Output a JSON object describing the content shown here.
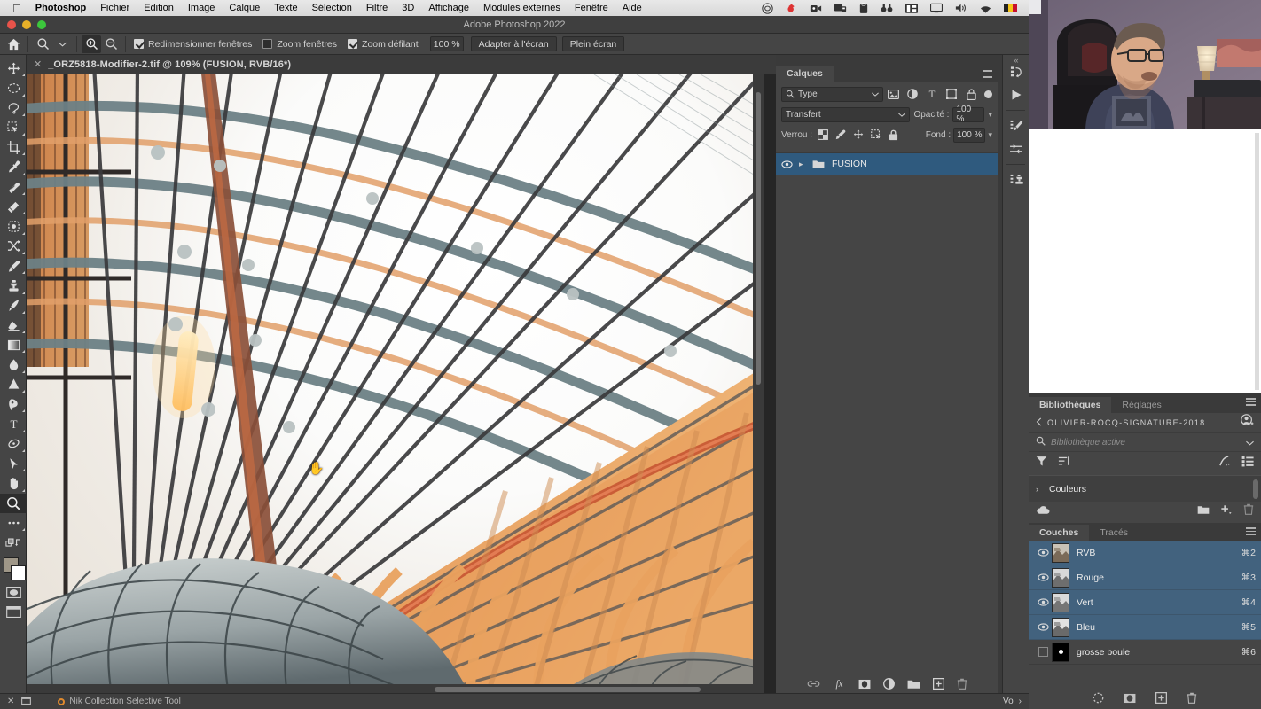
{
  "macmenu": {
    "apple": "apple-logo",
    "items": [
      "Photoshop",
      "Fichier",
      "Edition",
      "Image",
      "Calque",
      "Texte",
      "Sélection",
      "Filtre",
      "3D",
      "Affichage",
      "Modules externes",
      "Fenêtre",
      "Aide"
    ],
    "status_icons": [
      "creative-cloud-icon",
      "dropbox-icon",
      "screen-record-icon",
      "screenshot-icon",
      "clipboard-icon",
      "search-binoculars-icon",
      "display-layout-icon",
      "monitor-icon",
      "volume-icon",
      "wifi-icon",
      "belgium-flag-icon"
    ]
  },
  "titlebar": {
    "title": "Adobe Photoshop 2022"
  },
  "options": {
    "home_icon": "home-icon",
    "tool_icon": "zoom-tool-icon",
    "tool_chevron": "chevron-down-icon",
    "zoom_in": "zoom-in-icon",
    "zoom_out": "zoom-out-icon",
    "checkboxes": [
      {
        "label": "Redimensionner fenêtres",
        "checked": true
      },
      {
        "label": "Zoom fenêtres",
        "checked": false
      },
      {
        "label": "Zoom défilant",
        "checked": true
      }
    ],
    "zoom_value": "100 %",
    "fit_screen": "Adapter à l'écran",
    "full_screen": "Plein écran"
  },
  "toolbar": {
    "tools": [
      {
        "name": "move-tool",
        "selected": false
      },
      {
        "name": "marquee-tool",
        "selected": false
      },
      {
        "name": "lasso-tool",
        "selected": false
      },
      {
        "name": "quick-selection-tool",
        "selected": false
      },
      {
        "name": "crop-tool",
        "selected": false
      },
      {
        "name": "eyedropper-tool",
        "selected": false
      },
      {
        "name": "spot-healing-brush-tool",
        "selected": false
      },
      {
        "name": "patch-tool",
        "selected": false
      },
      {
        "name": "content-aware-move-tool",
        "selected": false
      },
      {
        "name": "shuffle-tool",
        "selected": false
      },
      {
        "name": "brush-tool",
        "selected": false
      },
      {
        "name": "clone-stamp-tool",
        "selected": false
      },
      {
        "name": "history-brush-tool",
        "selected": false
      },
      {
        "name": "eraser-tool",
        "selected": false
      },
      {
        "name": "gradient-tool",
        "selected": false
      },
      {
        "name": "blur-tool",
        "selected": false
      },
      {
        "name": "dodge-tool",
        "selected": false
      },
      {
        "name": "pen-tool",
        "selected": false
      },
      {
        "name": "type-tool",
        "selected": false
      },
      {
        "name": "path-selection-tool",
        "selected": false
      },
      {
        "name": "direct-selection-tool",
        "selected": false
      },
      {
        "name": "hand-tool",
        "selected": false
      },
      {
        "name": "zoom-tool",
        "selected": true
      },
      {
        "name": "edit-toolbar-tool",
        "selected": false
      },
      {
        "name": "swap-colors-icon",
        "selected": false
      }
    ],
    "foreground_color": "#9f9788",
    "background_color": "#ffffff",
    "quick_mask": "quick-mask-icon",
    "screen_mode": "screen-mode-icon"
  },
  "document": {
    "close_icon": "close-icon",
    "tab_title": "_ORZ5818-Modifier-2.tif @ 109% (FUSION, RVB/16*)"
  },
  "layers_panel": {
    "tabs": [
      {
        "label": "Calques",
        "active": true
      }
    ],
    "menu_icon": "panel-menu-icon",
    "filter_kind": "Type",
    "filter_icons": [
      "filter-pixel-icon",
      "filter-adjustment-icon",
      "filter-type-icon",
      "filter-shape-icon",
      "filter-smart-icon"
    ],
    "filter_toggle": "filter-enable-toggle",
    "blend_mode": "Transfert",
    "opacity_label": "Opacité :",
    "opacity_value": "100 %",
    "lock_label": "Verrou :",
    "lock_icons": [
      "lock-transparent-pixels-icon",
      "lock-image-pixels-icon",
      "lock-position-icon",
      "lock-artboard-icon",
      "lock-all-icon"
    ],
    "fill_label": "Fond :",
    "fill_value": "100 %",
    "layers": [
      {
        "name": "FUSION",
        "visible": true,
        "type": "group",
        "selected": true
      }
    ],
    "footer_icons": [
      "link-layers-icon",
      "layer-style-fx-icon",
      "add-layer-mask-icon",
      "new-adjustment-layer-icon",
      "new-group-icon",
      "new-layer-icon",
      "delete-layer-icon"
    ],
    "highlight_color": "#2f5a7e"
  },
  "mini_dock": {
    "collapse_icon": "collapse-panels-icon",
    "buttons": [
      "history-icon",
      "play-actions-icon",
      "adjustments-brush-icon",
      "properties-sliders-icon",
      "actions-stamp-icon"
    ]
  },
  "libraries_panel": {
    "tabs": [
      {
        "label": "Bibliothèques",
        "active": true
      },
      {
        "label": "Réglages",
        "active": false
      }
    ],
    "menu_icon": "panel-menu-icon",
    "back_icon": "chevron-left-icon",
    "library_name": "OLIVIER-ROCQ-SIGNATURE-2018",
    "account_icon": "add-collaborator-icon",
    "search_icon": "search-icon",
    "search_placeholder": "Bibliothèque active",
    "search_chevron": "chevron-down-icon",
    "tool_icons": [
      "filter-icon",
      "sort-icon",
      "brush-stroke-icon",
      "list-view-icon"
    ],
    "group_twisty": "chevron-right-icon",
    "group_label": "Couleurs",
    "footer_icons": [
      "cloud-sync-icon",
      "new-library-folder-icon",
      "add-element-icon",
      "delete-icon"
    ]
  },
  "channels_panel": {
    "tabs": [
      {
        "label": "Couches",
        "active": true
      },
      {
        "label": "Tracés",
        "active": false
      }
    ],
    "menu_icon": "panel-menu-icon",
    "columns": [
      "visibility",
      "thumbnail",
      "name",
      "shortcut"
    ],
    "channels": [
      {
        "name": "RVB",
        "shortcut": "⌘2",
        "visible": true,
        "selected": true,
        "kind": "composite"
      },
      {
        "name": "Rouge",
        "shortcut": "⌘3",
        "visible": true,
        "selected": true,
        "kind": "color"
      },
      {
        "name": "Vert",
        "shortcut": "⌘4",
        "visible": true,
        "selected": true,
        "kind": "color"
      },
      {
        "name": "Bleu",
        "shortcut": "⌘5",
        "visible": true,
        "selected": true,
        "kind": "color"
      },
      {
        "name": "grosse boule",
        "shortcut": "⌘6",
        "visible": false,
        "selected": false,
        "kind": "alpha"
      }
    ],
    "footer_icons": [
      "load-channel-as-selection-icon",
      "save-selection-as-channel-icon",
      "new-channel-icon",
      "delete-channel-icon"
    ],
    "highlight_color": "#42627e"
  },
  "statusbar": {
    "left_icons": [
      "close-icon",
      "window-icon"
    ],
    "plugin_status_dot": "orange-status-dot",
    "plugin_name": "Nik Collection Selective Tool",
    "overlay_text": "Vo",
    "overlay_chevron": "›"
  },
  "canvas": {
    "cursor": "hand-cursor",
    "hscrollbar": "horizontal-scrollbar",
    "vscrollbar": "vertical-scrollbar",
    "image_description": "architectural-glass-roof-photo"
  },
  "webcam": {
    "label": "webcam-overlay"
  }
}
